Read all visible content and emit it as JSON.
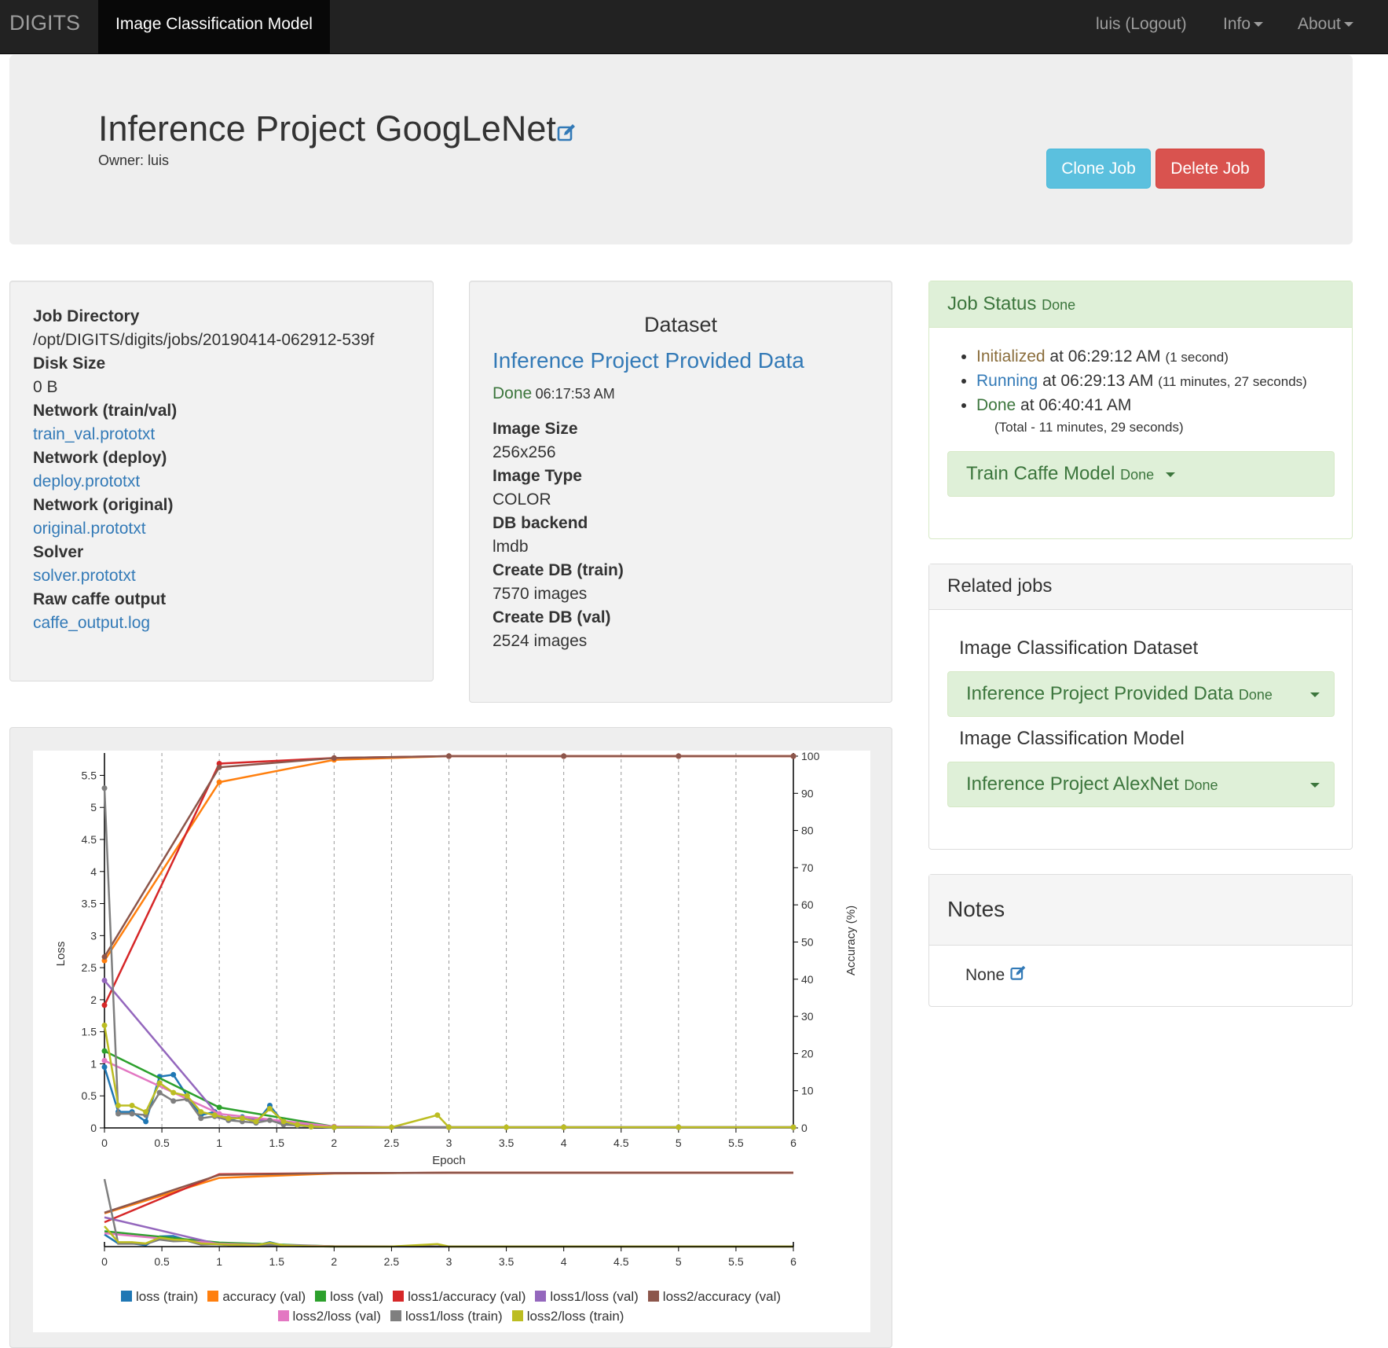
{
  "navbar": {
    "brand": "DIGITS",
    "active_tab": "Image Classification Model",
    "user_link": "luis (Logout)",
    "info_menu": "Info",
    "about_menu": "About"
  },
  "header": {
    "title": "Inference Project GoogLeNet",
    "owner": "Owner: luis",
    "clone_label": "Clone Job",
    "delete_label": "Delete Job"
  },
  "job_info": {
    "job_dir_label": "Job Directory",
    "job_dir": "/opt/DIGITS/digits/jobs/20190414-062912-539f",
    "disk_label": "Disk Size",
    "disk": "0 B",
    "net_trainval_label": "Network (train/val)",
    "net_trainval": "train_val.prototxt",
    "net_deploy_label": "Network (deploy)",
    "net_deploy": "deploy.prototxt",
    "net_original_label": "Network (original)",
    "net_original": "original.prototxt",
    "solver_label": "Solver",
    "solver": "solver.prototxt",
    "raw_label": "Raw caffe output",
    "raw": "caffe_output.log"
  },
  "dataset": {
    "heading": "Dataset",
    "name": "Inference Project Provided Data",
    "status": "Done",
    "time": "06:17:53 AM",
    "image_size_label": "Image Size",
    "image_size": "256x256",
    "image_type_label": "Image Type",
    "image_type": "COLOR",
    "db_backend_label": "DB backend",
    "db_backend": "lmdb",
    "create_train_label": "Create DB (train)",
    "create_train": "7570 images",
    "create_val_label": "Create DB (val)",
    "create_val": "2524 images"
  },
  "job_status": {
    "title": "Job Status",
    "status": "Done",
    "events": [
      {
        "state": "Initialized",
        "at": "at 06:29:12 AM",
        "duration": "(1 second)"
      },
      {
        "state": "Running",
        "at": "at 06:29:13 AM",
        "duration": "(11 minutes, 27 seconds)"
      },
      {
        "state": "Done",
        "at": "at 06:40:41 AM",
        "duration": ""
      }
    ],
    "total": "(Total - 11 minutes, 29 seconds)",
    "task_name": "Train Caffe Model",
    "task_status": "Done"
  },
  "related": {
    "title": "Related jobs",
    "dataset_label": "Image Classification Dataset",
    "dataset_job": "Inference Project Provided Data",
    "dataset_status": "Done",
    "model_label": "Image Classification Model",
    "model_job": "Inference Project AlexNet",
    "model_status": "Done"
  },
  "notes": {
    "title": "Notes",
    "value": "None"
  },
  "chart_data": {
    "type": "line",
    "xlabel": "Epoch",
    "ylabel": "Loss",
    "y2label": "Accuracy (%)",
    "xlim": [
      0,
      6
    ],
    "ylim": [
      0,
      5.8
    ],
    "y2lim": [
      0,
      100
    ],
    "x_ticks": [
      "0",
      "0.5",
      "1",
      "1.5",
      "2",
      "2.5",
      "3",
      "3.5",
      "4",
      "4.5",
      "5",
      "5.5",
      "6"
    ],
    "y_ticks": [
      "0",
      "0.5",
      "1",
      "1.5",
      "2",
      "2.5",
      "3",
      "3.5",
      "4",
      "4.5",
      "5",
      "5.5"
    ],
    "y2_ticks": [
      "0",
      "10",
      "20",
      "30",
      "40",
      "50",
      "60",
      "70",
      "80",
      "90",
      "100"
    ],
    "grid": "vertical dashed",
    "legend_position": "bottom",
    "series": [
      {
        "name": "loss (train)",
        "axis": "loss",
        "color": "#1f77b4",
        "x": [
          0,
          0.12,
          0.24,
          0.36,
          0.48,
          0.6,
          0.72,
          0.84,
          0.96,
          1.08,
          1.2,
          1.32,
          1.44,
          1.56,
          1.68,
          1.8,
          2,
          3,
          4,
          5,
          6
        ],
        "y": [
          0.95,
          0.25,
          0.25,
          0.1,
          0.8,
          0.83,
          0.5,
          0.2,
          0.25,
          0.12,
          0.17,
          0.08,
          0.35,
          0.08,
          0.04,
          0.02,
          0.01,
          0.01,
          0.01,
          0.01,
          0.01
        ]
      },
      {
        "name": "accuracy (val)",
        "axis": "acc",
        "color": "#ff7f0e",
        "x": [
          0,
          1,
          2,
          3,
          4,
          5,
          6
        ],
        "y": [
          45,
          93,
          99,
          100,
          100,
          100,
          100
        ]
      },
      {
        "name": "loss (val)",
        "axis": "loss",
        "color": "#2ca02c",
        "x": [
          0,
          1,
          2,
          3,
          4,
          5,
          6
        ],
        "y": [
          1.2,
          0.32,
          0.02,
          0.01,
          0.01,
          0.01,
          0.01
        ]
      },
      {
        "name": "loss1/accuracy (val)",
        "axis": "acc",
        "color": "#d62728",
        "x": [
          0,
          1,
          2,
          3,
          4,
          5,
          6
        ],
        "y": [
          33,
          98,
          99.5,
          100,
          100,
          100,
          100
        ]
      },
      {
        "name": "loss1/loss (val)",
        "axis": "loss",
        "color": "#9467bd",
        "x": [
          0,
          1,
          2,
          3,
          4,
          5,
          6
        ],
        "y": [
          2.3,
          0.18,
          0.02,
          0.01,
          0.01,
          0.01,
          0.01
        ]
      },
      {
        "name": "loss2/accuracy (val)",
        "axis": "acc",
        "color": "#8c564b",
        "x": [
          0,
          1,
          2,
          3,
          4,
          5,
          6
        ],
        "y": [
          46,
          97,
          99.5,
          100,
          100,
          100,
          100
        ]
      },
      {
        "name": "loss2/loss (val)",
        "axis": "loss",
        "color": "#e377c2",
        "x": [
          0,
          1,
          2,
          3,
          4,
          5,
          6
        ],
        "y": [
          1.05,
          0.22,
          0.02,
          0.01,
          0.01,
          0.01,
          0.01
        ]
      },
      {
        "name": "loss1/loss (train)",
        "axis": "loss",
        "color": "#7f7f7f",
        "x": [
          0,
          0.12,
          0.24,
          0.36,
          0.48,
          0.6,
          0.72,
          0.84,
          0.96,
          1.08,
          1.2,
          1.32,
          1.44,
          1.56,
          1.68,
          1.8,
          2,
          3,
          4,
          5,
          6
        ],
        "y": [
          5.3,
          0.22,
          0.22,
          0.2,
          0.55,
          0.42,
          0.45,
          0.15,
          0.18,
          0.12,
          0.1,
          0.08,
          0.12,
          0.05,
          0.04,
          0.02,
          0.01,
          0.01,
          0.01,
          0.01,
          0.01
        ]
      },
      {
        "name": "loss2/loss (train)",
        "axis": "loss",
        "color": "#bcbd22",
        "x": [
          0,
          0.12,
          0.24,
          0.36,
          0.48,
          0.6,
          0.72,
          0.84,
          0.96,
          1.08,
          1.2,
          1.32,
          1.44,
          1.56,
          1.68,
          1.8,
          2,
          2.5,
          2.9,
          3,
          3.5,
          4,
          5,
          6
        ],
        "y": [
          1.6,
          0.35,
          0.35,
          0.25,
          0.7,
          0.55,
          0.5,
          0.25,
          0.2,
          0.15,
          0.15,
          0.1,
          0.3,
          0.1,
          0.05,
          0.02,
          0.01,
          0.01,
          0.2,
          0.01,
          0.01,
          0.01,
          0.01,
          0.01
        ]
      }
    ]
  }
}
